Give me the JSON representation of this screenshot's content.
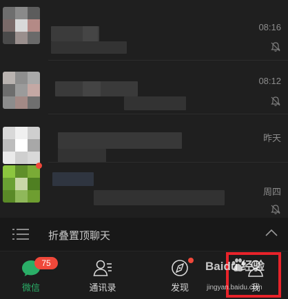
{
  "chats": [
    {
      "time": "08:16",
      "muted": true,
      "unread_dot": false
    },
    {
      "time": "08:12",
      "muted": true,
      "unread_dot": false
    },
    {
      "time": "昨天",
      "muted": false,
      "unread_dot": false
    },
    {
      "time": "周四",
      "muted": true,
      "unread_dot": true
    }
  ],
  "fold_bar": {
    "label": "折叠置顶聊天"
  },
  "tabs": [
    {
      "label": "微信",
      "badge": "75",
      "active": true,
      "icon": "chat-bubble-icon"
    },
    {
      "label": "通讯录",
      "active": false,
      "icon": "contacts-icon"
    },
    {
      "label": "发现",
      "active": false,
      "dot": true,
      "icon": "compass-icon"
    },
    {
      "label": "我",
      "active": false,
      "icon": "profile-icon"
    }
  ],
  "watermark": {
    "brand": "Baidu 经验",
    "url": "jingyan.baidu.com"
  },
  "colors": {
    "accent": "#2aae67",
    "badge": "#f0483a",
    "highlight": "#e8232a",
    "background": "#1f1f1f"
  }
}
